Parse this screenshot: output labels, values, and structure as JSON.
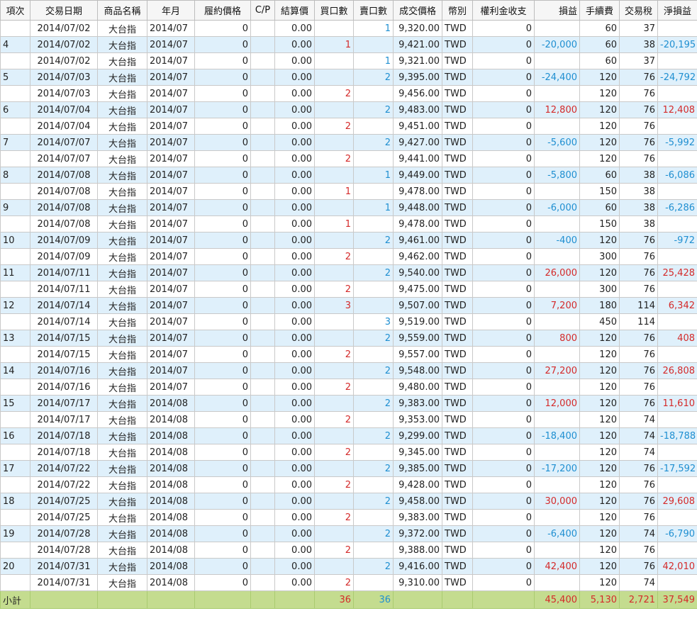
{
  "headers": {
    "item": "項次",
    "date": "交易日期",
    "product": "商品名稱",
    "month": "年月",
    "strike": "履約價格",
    "cp": "C/P",
    "settle": "結算價",
    "buy": "買口數",
    "sell": "賣口數",
    "price": "成交價格",
    "currency": "幣別",
    "premium": "權利金收支",
    "pnl": "損益",
    "fee": "手續費",
    "tax": "交易稅",
    "net": "淨損益"
  },
  "rows": [
    {
      "item": "",
      "date": "2014/07/02",
      "product": "大台指",
      "month": "2014/07",
      "strike": "0",
      "cp": "",
      "settle": "0.00",
      "buy": "",
      "sell": "1",
      "price": "9,320.00",
      "currency": "TWD",
      "premium": "0",
      "pnl": "",
      "fee": "60",
      "tax": "37",
      "net": ""
    },
    {
      "item": "4",
      "date": "2014/07/02",
      "product": "大台指",
      "month": "2014/07",
      "strike": "0",
      "cp": "",
      "settle": "0.00",
      "buy": "1",
      "sell": "",
      "price": "9,421.00",
      "currency": "TWD",
      "premium": "0",
      "pnl": "-20,000",
      "fee": "60",
      "tax": "38",
      "net": "-20,195"
    },
    {
      "item": "",
      "date": "2014/07/02",
      "product": "大台指",
      "month": "2014/07",
      "strike": "0",
      "cp": "",
      "settle": "0.00",
      "buy": "",
      "sell": "1",
      "price": "9,321.00",
      "currency": "TWD",
      "premium": "0",
      "pnl": "",
      "fee": "60",
      "tax": "37",
      "net": ""
    },
    {
      "item": "5",
      "date": "2014/07/03",
      "product": "大台指",
      "month": "2014/07",
      "strike": "0",
      "cp": "",
      "settle": "0.00",
      "buy": "",
      "sell": "2",
      "price": "9,395.00",
      "currency": "TWD",
      "premium": "0",
      "pnl": "-24,400",
      "fee": "120",
      "tax": "76",
      "net": "-24,792"
    },
    {
      "item": "",
      "date": "2014/07/03",
      "product": "大台指",
      "month": "2014/07",
      "strike": "0",
      "cp": "",
      "settle": "0.00",
      "buy": "2",
      "sell": "",
      "price": "9,456.00",
      "currency": "TWD",
      "premium": "0",
      "pnl": "",
      "fee": "120",
      "tax": "76",
      "net": ""
    },
    {
      "item": "6",
      "date": "2014/07/04",
      "product": "大台指",
      "month": "2014/07",
      "strike": "0",
      "cp": "",
      "settle": "0.00",
      "buy": "",
      "sell": "2",
      "price": "9,483.00",
      "currency": "TWD",
      "premium": "0",
      "pnl": "12,800",
      "fee": "120",
      "tax": "76",
      "net": "12,408"
    },
    {
      "item": "",
      "date": "2014/07/04",
      "product": "大台指",
      "month": "2014/07",
      "strike": "0",
      "cp": "",
      "settle": "0.00",
      "buy": "2",
      "sell": "",
      "price": "9,451.00",
      "currency": "TWD",
      "premium": "0",
      "pnl": "",
      "fee": "120",
      "tax": "76",
      "net": ""
    },
    {
      "item": "7",
      "date": "2014/07/07",
      "product": "大台指",
      "month": "2014/07",
      "strike": "0",
      "cp": "",
      "settle": "0.00",
      "buy": "",
      "sell": "2",
      "price": "9,427.00",
      "currency": "TWD",
      "premium": "0",
      "pnl": "-5,600",
      "fee": "120",
      "tax": "76",
      "net": "-5,992"
    },
    {
      "item": "",
      "date": "2014/07/07",
      "product": "大台指",
      "month": "2014/07",
      "strike": "0",
      "cp": "",
      "settle": "0.00",
      "buy": "2",
      "sell": "",
      "price": "9,441.00",
      "currency": "TWD",
      "premium": "0",
      "pnl": "",
      "fee": "120",
      "tax": "76",
      "net": ""
    },
    {
      "item": "8",
      "date": "2014/07/08",
      "product": "大台指",
      "month": "2014/07",
      "strike": "0",
      "cp": "",
      "settle": "0.00",
      "buy": "",
      "sell": "1",
      "price": "9,449.00",
      "currency": "TWD",
      "premium": "0",
      "pnl": "-5,800",
      "fee": "60",
      "tax": "38",
      "net": "-6,086"
    },
    {
      "item": "",
      "date": "2014/07/08",
      "product": "大台指",
      "month": "2014/07",
      "strike": "0",
      "cp": "",
      "settle": "0.00",
      "buy": "1",
      "sell": "",
      "price": "9,478.00",
      "currency": "TWD",
      "premium": "0",
      "pnl": "",
      "fee": "150",
      "tax": "38",
      "net": ""
    },
    {
      "item": "9",
      "date": "2014/07/08",
      "product": "大台指",
      "month": "2014/07",
      "strike": "0",
      "cp": "",
      "settle": "0.00",
      "buy": "",
      "sell": "1",
      "price": "9,448.00",
      "currency": "TWD",
      "premium": "0",
      "pnl": "-6,000",
      "fee": "60",
      "tax": "38",
      "net": "-6,286"
    },
    {
      "item": "",
      "date": "2014/07/08",
      "product": "大台指",
      "month": "2014/07",
      "strike": "0",
      "cp": "",
      "settle": "0.00",
      "buy": "1",
      "sell": "",
      "price": "9,478.00",
      "currency": "TWD",
      "premium": "0",
      "pnl": "",
      "fee": "150",
      "tax": "38",
      "net": ""
    },
    {
      "item": "10",
      "date": "2014/07/09",
      "product": "大台指",
      "month": "2014/07",
      "strike": "0",
      "cp": "",
      "settle": "0.00",
      "buy": "",
      "sell": "2",
      "price": "9,461.00",
      "currency": "TWD",
      "premium": "0",
      "pnl": "-400",
      "fee": "120",
      "tax": "76",
      "net": "-972"
    },
    {
      "item": "",
      "date": "2014/07/09",
      "product": "大台指",
      "month": "2014/07",
      "strike": "0",
      "cp": "",
      "settle": "0.00",
      "buy": "2",
      "sell": "",
      "price": "9,462.00",
      "currency": "TWD",
      "premium": "0",
      "pnl": "",
      "fee": "300",
      "tax": "76",
      "net": ""
    },
    {
      "item": "11",
      "date": "2014/07/11",
      "product": "大台指",
      "month": "2014/07",
      "strike": "0",
      "cp": "",
      "settle": "0.00",
      "buy": "",
      "sell": "2",
      "price": "9,540.00",
      "currency": "TWD",
      "premium": "0",
      "pnl": "26,000",
      "fee": "120",
      "tax": "76",
      "net": "25,428"
    },
    {
      "item": "",
      "date": "2014/07/11",
      "product": "大台指",
      "month": "2014/07",
      "strike": "0",
      "cp": "",
      "settle": "0.00",
      "buy": "2",
      "sell": "",
      "price": "9,475.00",
      "currency": "TWD",
      "premium": "0",
      "pnl": "",
      "fee": "300",
      "tax": "76",
      "net": ""
    },
    {
      "item": "12",
      "date": "2014/07/14",
      "product": "大台指",
      "month": "2014/07",
      "strike": "0",
      "cp": "",
      "settle": "0.00",
      "buy": "3",
      "sell": "",
      "price": "9,507.00",
      "currency": "TWD",
      "premium": "0",
      "pnl": "7,200",
      "fee": "180",
      "tax": "114",
      "net": "6,342"
    },
    {
      "item": "",
      "date": "2014/07/14",
      "product": "大台指",
      "month": "2014/07",
      "strike": "0",
      "cp": "",
      "settle": "0.00",
      "buy": "",
      "sell": "3",
      "price": "9,519.00",
      "currency": "TWD",
      "premium": "0",
      "pnl": "",
      "fee": "450",
      "tax": "114",
      "net": ""
    },
    {
      "item": "13",
      "date": "2014/07/15",
      "product": "大台指",
      "month": "2014/07",
      "strike": "0",
      "cp": "",
      "settle": "0.00",
      "buy": "",
      "sell": "2",
      "price": "9,559.00",
      "currency": "TWD",
      "premium": "0",
      "pnl": "800",
      "fee": "120",
      "tax": "76",
      "net": "408"
    },
    {
      "item": "",
      "date": "2014/07/15",
      "product": "大台指",
      "month": "2014/07",
      "strike": "0",
      "cp": "",
      "settle": "0.00",
      "buy": "2",
      "sell": "",
      "price": "9,557.00",
      "currency": "TWD",
      "premium": "0",
      "pnl": "",
      "fee": "120",
      "tax": "76",
      "net": ""
    },
    {
      "item": "14",
      "date": "2014/07/16",
      "product": "大台指",
      "month": "2014/07",
      "strike": "0",
      "cp": "",
      "settle": "0.00",
      "buy": "",
      "sell": "2",
      "price": "9,548.00",
      "currency": "TWD",
      "premium": "0",
      "pnl": "27,200",
      "fee": "120",
      "tax": "76",
      "net": "26,808"
    },
    {
      "item": "",
      "date": "2014/07/16",
      "product": "大台指",
      "month": "2014/07",
      "strike": "0",
      "cp": "",
      "settle": "0.00",
      "buy": "2",
      "sell": "",
      "price": "9,480.00",
      "currency": "TWD",
      "premium": "0",
      "pnl": "",
      "fee": "120",
      "tax": "76",
      "net": ""
    },
    {
      "item": "15",
      "date": "2014/07/17",
      "product": "大台指",
      "month": "2014/08",
      "strike": "0",
      "cp": "",
      "settle": "0.00",
      "buy": "",
      "sell": "2",
      "price": "9,383.00",
      "currency": "TWD",
      "premium": "0",
      "pnl": "12,000",
      "fee": "120",
      "tax": "76",
      "net": "11,610"
    },
    {
      "item": "",
      "date": "2014/07/17",
      "product": "大台指",
      "month": "2014/08",
      "strike": "0",
      "cp": "",
      "settle": "0.00",
      "buy": "2",
      "sell": "",
      "price": "9,353.00",
      "currency": "TWD",
      "premium": "0",
      "pnl": "",
      "fee": "120",
      "tax": "74",
      "net": ""
    },
    {
      "item": "16",
      "date": "2014/07/18",
      "product": "大台指",
      "month": "2014/08",
      "strike": "0",
      "cp": "",
      "settle": "0.00",
      "buy": "",
      "sell": "2",
      "price": "9,299.00",
      "currency": "TWD",
      "premium": "0",
      "pnl": "-18,400",
      "fee": "120",
      "tax": "74",
      "net": "-18,788"
    },
    {
      "item": "",
      "date": "2014/07/18",
      "product": "大台指",
      "month": "2014/08",
      "strike": "0",
      "cp": "",
      "settle": "0.00",
      "buy": "2",
      "sell": "",
      "price": "9,345.00",
      "currency": "TWD",
      "premium": "0",
      "pnl": "",
      "fee": "120",
      "tax": "74",
      "net": ""
    },
    {
      "item": "17",
      "date": "2014/07/22",
      "product": "大台指",
      "month": "2014/08",
      "strike": "0",
      "cp": "",
      "settle": "0.00",
      "buy": "",
      "sell": "2",
      "price": "9,385.00",
      "currency": "TWD",
      "premium": "0",
      "pnl": "-17,200",
      "fee": "120",
      "tax": "76",
      "net": "-17,592"
    },
    {
      "item": "",
      "date": "2014/07/22",
      "product": "大台指",
      "month": "2014/08",
      "strike": "0",
      "cp": "",
      "settle": "0.00",
      "buy": "2",
      "sell": "",
      "price": "9,428.00",
      "currency": "TWD",
      "premium": "0",
      "pnl": "",
      "fee": "120",
      "tax": "76",
      "net": ""
    },
    {
      "item": "18",
      "date": "2014/07/25",
      "product": "大台指",
      "month": "2014/08",
      "strike": "0",
      "cp": "",
      "settle": "0.00",
      "buy": "",
      "sell": "2",
      "price": "9,458.00",
      "currency": "TWD",
      "premium": "0",
      "pnl": "30,000",
      "fee": "120",
      "tax": "76",
      "net": "29,608"
    },
    {
      "item": "",
      "date": "2014/07/25",
      "product": "大台指",
      "month": "2014/08",
      "strike": "0",
      "cp": "",
      "settle": "0.00",
      "buy": "2",
      "sell": "",
      "price": "9,383.00",
      "currency": "TWD",
      "premium": "0",
      "pnl": "",
      "fee": "120",
      "tax": "76",
      "net": ""
    },
    {
      "item": "19",
      "date": "2014/07/28",
      "product": "大台指",
      "month": "2014/08",
      "strike": "0",
      "cp": "",
      "settle": "0.00",
      "buy": "",
      "sell": "2",
      "price": "9,372.00",
      "currency": "TWD",
      "premium": "0",
      "pnl": "-6,400",
      "fee": "120",
      "tax": "74",
      "net": "-6,790"
    },
    {
      "item": "",
      "date": "2014/07/28",
      "product": "大台指",
      "month": "2014/08",
      "strike": "0",
      "cp": "",
      "settle": "0.00",
      "buy": "2",
      "sell": "",
      "price": "9,388.00",
      "currency": "TWD",
      "premium": "0",
      "pnl": "",
      "fee": "120",
      "tax": "76",
      "net": ""
    },
    {
      "item": "20",
      "date": "2014/07/31",
      "product": "大台指",
      "month": "2014/08",
      "strike": "0",
      "cp": "",
      "settle": "0.00",
      "buy": "",
      "sell": "2",
      "price": "9,416.00",
      "currency": "TWD",
      "premium": "0",
      "pnl": "42,400",
      "fee": "120",
      "tax": "76",
      "net": "42,010"
    },
    {
      "item": "",
      "date": "2014/07/31",
      "product": "大台指",
      "month": "2014/08",
      "strike": "0",
      "cp": "",
      "settle": "0.00",
      "buy": "2",
      "sell": "",
      "price": "9,310.00",
      "currency": "TWD",
      "premium": "0",
      "pnl": "",
      "fee": "120",
      "tax": "74",
      "net": ""
    }
  ],
  "subtotal": {
    "label": "小計",
    "buy": "36",
    "sell": "36",
    "pnl": "45,400",
    "fee": "5,130",
    "tax": "2,721",
    "net": "37,549"
  },
  "colors": {
    "row_blue": "#dff0fb",
    "row_white": "#ffffff",
    "subtotal_green": "#c4dc8f",
    "positive_red": "#d42a2a",
    "negative_blue": "#1f8fd1"
  }
}
